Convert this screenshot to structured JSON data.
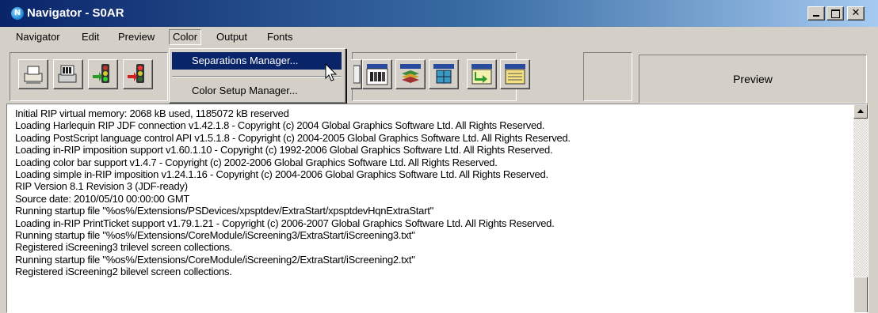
{
  "window": {
    "title": "Navigator - S0AR",
    "app_icon_letter": "N"
  },
  "menubar": [
    "Navigator",
    "Edit",
    "Preview",
    "Color",
    "Output",
    "Fonts"
  ],
  "open_menu": "Color",
  "color_menu": {
    "items": [
      "Separations Manager...",
      "Color Setup Manager..."
    ],
    "highlighted": "Separations Manager..."
  },
  "toolbar": {
    "buttons": [
      "print-icon",
      "print-queue-icon",
      "traffic-light-green-icon",
      "traffic-light-red-icon",
      "page-setup-icon",
      "separations-icon",
      "stack-icon",
      "imposition-icon",
      "transfer-icon",
      "output-icon"
    ],
    "preview_label": "Preview"
  },
  "log": {
    "lines": [
      "Initial RIP virtual memory: 2068 kB used, 1185072 kB reserved",
      "Loading Harlequin RIP JDF connection v1.42.1.8 - Copyright (c) 2004 Global Graphics Software Ltd. All Rights Reserved.",
      "Loading PostScript language control API v1.5.1.8 - Copyright (c) 2004-2005 Global Graphics Software Ltd. All Rights Reserved.",
      "Loading in-RIP imposition support v1.60.1.10 - Copyright (c) 1992-2006 Global Graphics Software Ltd. All Rights Reserved.",
      "Loading color bar support v1.4.7 - Copyright (c) 2002-2006 Global Graphics Software Ltd. All Rights Reserved.",
      "Loading simple in-RIP imposition v1.24.1.16 - Copyright (c) 2004-2006 Global Graphics Software Ltd. All Rights Reserved.",
      "RIP Version 8.1 Revision 3 (JDF-ready)",
      "Source date: 2010/05/10 00:00:00 GMT",
      "Running startup file \"%os%/Extensions/PSDevices/xpsptdev/ExtraStart/xpsptdevHqnExtraStart\"",
      "Loading in-RIP PrintTicket support v1.79.1.21 - Copyright (c) 2006-2007 Global Graphics Software Ltd. All Rights Reserved.",
      "Running startup file \"%os%/Extensions/CoreModule/iScreening3/ExtraStart/iScreening3.txt\"",
      "Registered iScreening3 trilevel screen collections.",
      "Running startup file \"%os%/Extensions/CoreModule/iScreening2/ExtraStart/iScreening2.txt\"",
      "Registered iScreening2 bilevel screen collections."
    ]
  }
}
